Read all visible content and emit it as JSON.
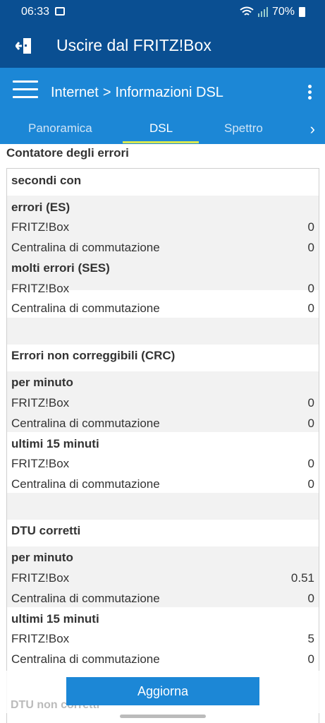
{
  "status": {
    "time": "06:33",
    "battery": "70%"
  },
  "header": {
    "title": "Uscire dal FRITZ!Box"
  },
  "nav": {
    "crumb1": "Internet",
    "separator": ">",
    "crumb2": "Informazioni DSL",
    "tabs": [
      "Panoramica",
      "DSL",
      "Spettro"
    ]
  },
  "section": {
    "title": "Contatore degli errori"
  },
  "rows": [
    {
      "label": "secondi con",
      "value": ""
    },
    {
      "label": "errori (ES)",
      "value": ""
    },
    {
      "label": "FRITZ!Box",
      "value": "0"
    },
    {
      "label": "Centralina di commutazione",
      "value": "0"
    },
    {
      "label": "molti errori (SES)",
      "value": ""
    },
    {
      "label": "FRITZ!Box",
      "value": "0"
    },
    {
      "label": "Centralina di commutazione",
      "value": "0"
    },
    {
      "label": "Errori non correggibili (CRC)",
      "value": ""
    },
    {
      "label": "per minuto",
      "value": ""
    },
    {
      "label": "FRITZ!Box",
      "value": "0"
    },
    {
      "label": "Centralina di commutazione",
      "value": "0"
    },
    {
      "label": "ultimi 15 minuti",
      "value": ""
    },
    {
      "label": "FRITZ!Box",
      "value": "0"
    },
    {
      "label": "Centralina di commutazione",
      "value": "0"
    },
    {
      "label": "DTU corretti",
      "value": ""
    },
    {
      "label": "per minuto",
      "value": ""
    },
    {
      "label": "FRITZ!Box",
      "value": "0.51"
    },
    {
      "label": "Centralina di commutazione",
      "value": "0"
    },
    {
      "label": "ultimi 15 minuti",
      "value": ""
    },
    {
      "label": "FRITZ!Box",
      "value": "5"
    },
    {
      "label": "Centralina di commutazione",
      "value": "0"
    }
  ],
  "footer": {
    "button": "Aggiorna",
    "next_section": "DTU non corretti"
  }
}
